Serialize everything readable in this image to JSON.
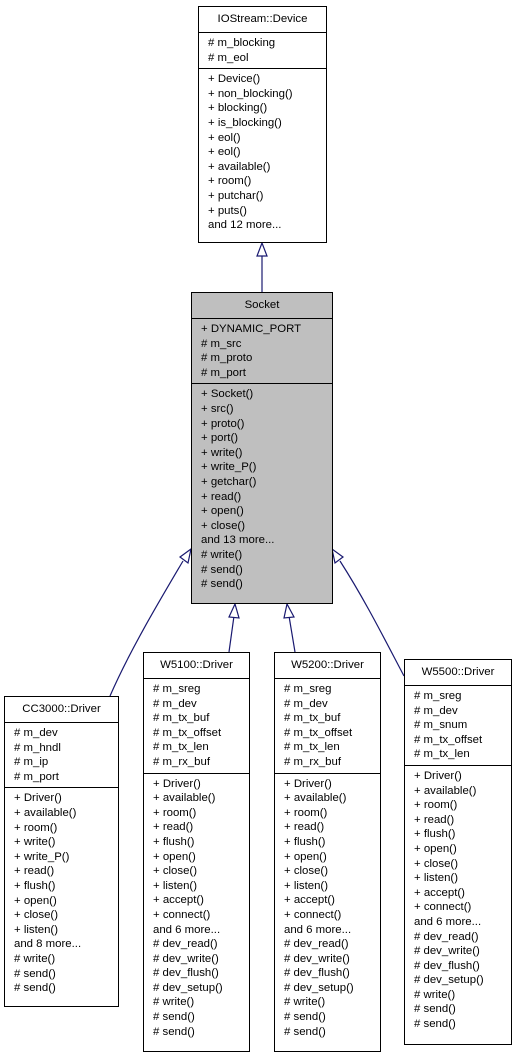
{
  "diagram": {
    "type": "class-inheritance",
    "classes": {
      "iostream_device": {
        "name": "IOStream::Device",
        "attributes": [
          "# m_blocking",
          "# m_eol"
        ],
        "methods": [
          "+ Device()",
          "+ non_blocking()",
          "+ blocking()",
          "+ is_blocking()",
          "+ eol()",
          "+ eol()",
          "+ available()",
          "+ room()",
          "+ putchar()",
          "+ puts()",
          "and 12 more..."
        ]
      },
      "socket": {
        "name": "Socket",
        "highlighted": true,
        "attributes": [
          "+ DYNAMIC_PORT",
          "# m_src",
          "# m_proto",
          "# m_port"
        ],
        "methods": [
          "+ Socket()",
          "+ src()",
          "+ proto()",
          "+ port()",
          "+ write()",
          "+ write_P()",
          "+ getchar()",
          "+ read()",
          "+ open()",
          "+ close()",
          "and 13 more...",
          "# write()",
          "# send()",
          "# send()"
        ]
      },
      "cc3000_driver": {
        "name": "CC3000::Driver",
        "attributes": [
          "# m_dev",
          "# m_hndl",
          "# m_ip",
          "# m_port"
        ],
        "methods": [
          "+ Driver()",
          "+ available()",
          "+ room()",
          "+ write()",
          "+ write_P()",
          "+ read()",
          "+ flush()",
          "+ open()",
          "+ close()",
          "+ listen()",
          "and 8 more...",
          "# write()",
          "# send()",
          "# send()"
        ]
      },
      "w5100_driver": {
        "name": "W5100::Driver",
        "attributes": [
          "# m_sreg",
          "# m_dev",
          "# m_tx_buf",
          "# m_tx_offset",
          "# m_tx_len",
          "# m_rx_buf"
        ],
        "methods": [
          "+ Driver()",
          "+ available()",
          "+ room()",
          "+ read()",
          "+ flush()",
          "+ open()",
          "+ close()",
          "+ listen()",
          "+ accept()",
          "+ connect()",
          "and 6 more...",
          "# dev_read()",
          "# dev_write()",
          "# dev_flush()",
          "# dev_setup()",
          "# write()",
          "# send()",
          "# send()"
        ]
      },
      "w5200_driver": {
        "name": "W5200::Driver",
        "attributes": [
          "# m_sreg",
          "# m_dev",
          "# m_tx_buf",
          "# m_tx_offset",
          "# m_tx_len",
          "# m_rx_buf"
        ],
        "methods": [
          "+ Driver()",
          "+ available()",
          "+ room()",
          "+ read()",
          "+ flush()",
          "+ open()",
          "+ close()",
          "+ listen()",
          "+ accept()",
          "+ connect()",
          "and 6 more...",
          "# dev_read()",
          "# dev_write()",
          "# dev_flush()",
          "# dev_setup()",
          "# write()",
          "# send()",
          "# send()"
        ]
      },
      "w5500_driver": {
        "name": "W5500::Driver",
        "attributes": [
          "# m_sreg",
          "# m_dev",
          "# m_snum",
          "# m_tx_offset",
          "# m_tx_len"
        ],
        "methods": [
          "+ Driver()",
          "+ available()",
          "+ room()",
          "+ read()",
          "+ flush()",
          "+ open()",
          "+ close()",
          "+ listen()",
          "+ accept()",
          "+ connect()",
          "and 6 more...",
          "# dev_read()",
          "# dev_write()",
          "# dev_flush()",
          "# dev_setup()",
          "# write()",
          "# send()",
          "# send()"
        ]
      }
    },
    "edges": [
      {
        "from": "socket",
        "to": "iostream_device",
        "kind": "inherits"
      },
      {
        "from": "cc3000_driver",
        "to": "socket",
        "kind": "inherits"
      },
      {
        "from": "w5100_driver",
        "to": "socket",
        "kind": "inherits"
      },
      {
        "from": "w5200_driver",
        "to": "socket",
        "kind": "inherits"
      },
      {
        "from": "w5500_driver",
        "to": "socket",
        "kind": "inherits"
      }
    ],
    "colors": {
      "edge": "#191970",
      "highlight_fill": "#bfbfbf",
      "box_fill": "#ffffff",
      "border": "#000000"
    }
  }
}
